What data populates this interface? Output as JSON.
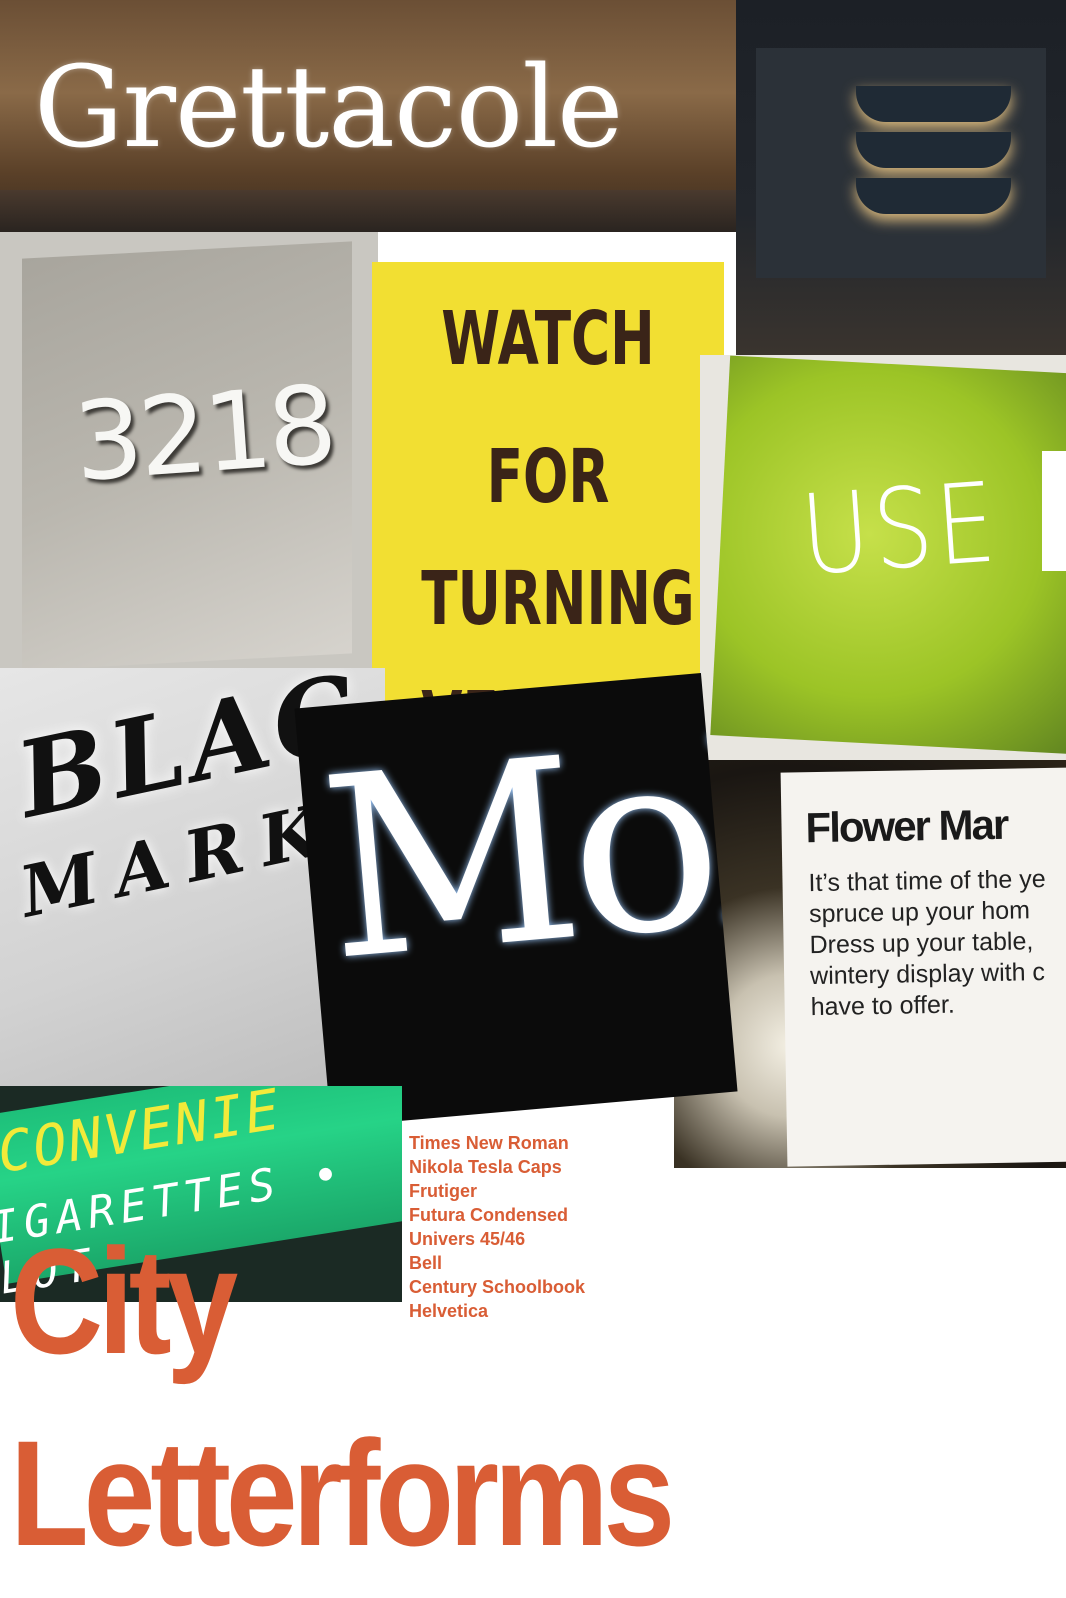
{
  "photos": {
    "grettacole": {
      "text": "Grettacole"
    },
    "plaque": {
      "text": "3218"
    },
    "caution": {
      "lines": [
        "WATCH",
        "FOR",
        "TURNING",
        "VEHICLES"
      ]
    },
    "green_sign": {
      "text": "USE"
    },
    "black_market": {
      "line1": "BLAC",
      "line2": "MARK"
    },
    "mob": {
      "text": "Mob"
    },
    "flower_card": {
      "heading": "Flower Mar",
      "body": [
        "It’s that time of the ye",
        "spruce up your hom",
        "Dress up your table,",
        "wintery display with c",
        "have to offer."
      ]
    },
    "convenience": {
      "line1": "CONVENIE",
      "line2a": "IGARETTES",
      "line2b": "LOT"
    }
  },
  "fonts": [
    "Times New Roman",
    "Nikola Tesla Caps",
    "Frutiger",
    "Futura Condensed",
    "Univers 45/46",
    "Bell",
    "Century Schoolbook",
    "Helvetica"
  ],
  "title": {
    "line1": "City",
    "line2": "Letterforms"
  },
  "colors": {
    "accent": "#d95d35",
    "caution_yellow": "#f2df32",
    "sign_green": "#26d387"
  }
}
